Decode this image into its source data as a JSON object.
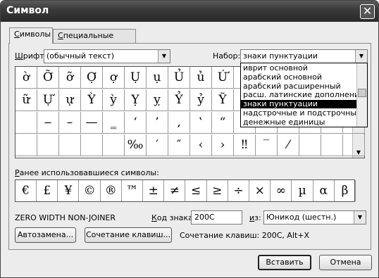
{
  "window": {
    "title": "Символ",
    "close_glyph": "✕"
  },
  "tabs": [
    {
      "label_u": "С",
      "label_rest": "имволы",
      "active": true
    },
    {
      "label_u": "С",
      "label_rest": "пециальные знаки",
      "active": false
    }
  ],
  "font": {
    "label_u": "Ш",
    "label_rest": "рифт:",
    "value": "(обычный текст)"
  },
  "subset": {
    "label": "Набор:",
    "value": "знаки пунктуации"
  },
  "subset_options": [
    "иврит основной",
    "арабский основной",
    "арабский расширенный",
    "расш. латинские дополнения",
    "знаки пунктуации",
    "надстрочные и подстрочные",
    "денежные единицы"
  ],
  "subset_selected_index": 4,
  "symbol_grid": [
    [
      "ờ",
      "Ỡ",
      "ỡ",
      "Ợ",
      "ợ",
      "Ụ",
      "ụ",
      "Ủ",
      "ủ",
      "Ứ",
      "ứ",
      "Ừ",
      "ừ",
      "Ử",
      "ử",
      "Ữ"
    ],
    [
      "ữ",
      "Ự",
      "ự",
      "Ỳ",
      "ỳ",
      "Ỵ",
      "ỵ",
      "Ỷ",
      "ỷ",
      "Ỹ",
      "ỹ",
      "",
      "",
      "",
      "",
      ""
    ],
    [
      "",
      "‒",
      "–",
      "—",
      "‗",
      "‘",
      "’",
      "‚",
      "‛",
      "“",
      "”",
      "",
      "",
      "",
      "",
      ""
    ],
    [
      "",
      "",
      "",
      "",
      "",
      "‰",
      "′",
      "″",
      "‹",
      "›",
      "‼",
      "‾",
      "⁄",
      "",
      "",
      ""
    ]
  ],
  "recent": {
    "label_u": "Р",
    "label_rest": "анее использовавшиеся символы:",
    "symbols": [
      "€",
      "£",
      "¥",
      "©",
      "®",
      "™",
      "±",
      "≠",
      "≤",
      "≥",
      "÷",
      "×",
      "∞",
      "µ",
      "α",
      "β"
    ]
  },
  "char_name": "ZERO WIDTH NON-JOINER",
  "code": {
    "label_u": "К",
    "label_rest": "од знака:",
    "value": "200C"
  },
  "from": {
    "label_u": "и",
    "label_rest": "з:",
    "value": "Юникод (шестн.)"
  },
  "buttons": {
    "autocorrect": "Автозамена...",
    "shortcut_key": "Сочетание клавиш...",
    "insert": "Вставить",
    "cancel": "Отмена"
  },
  "shortcut_text": "Сочетание клавиш: 200C, Alt+X",
  "icons": {
    "dropdown": "chevron-down-icon",
    "scroll_up": "arrow-up-icon",
    "scroll_down": "arrow-down-icon",
    "close": "close-icon"
  }
}
